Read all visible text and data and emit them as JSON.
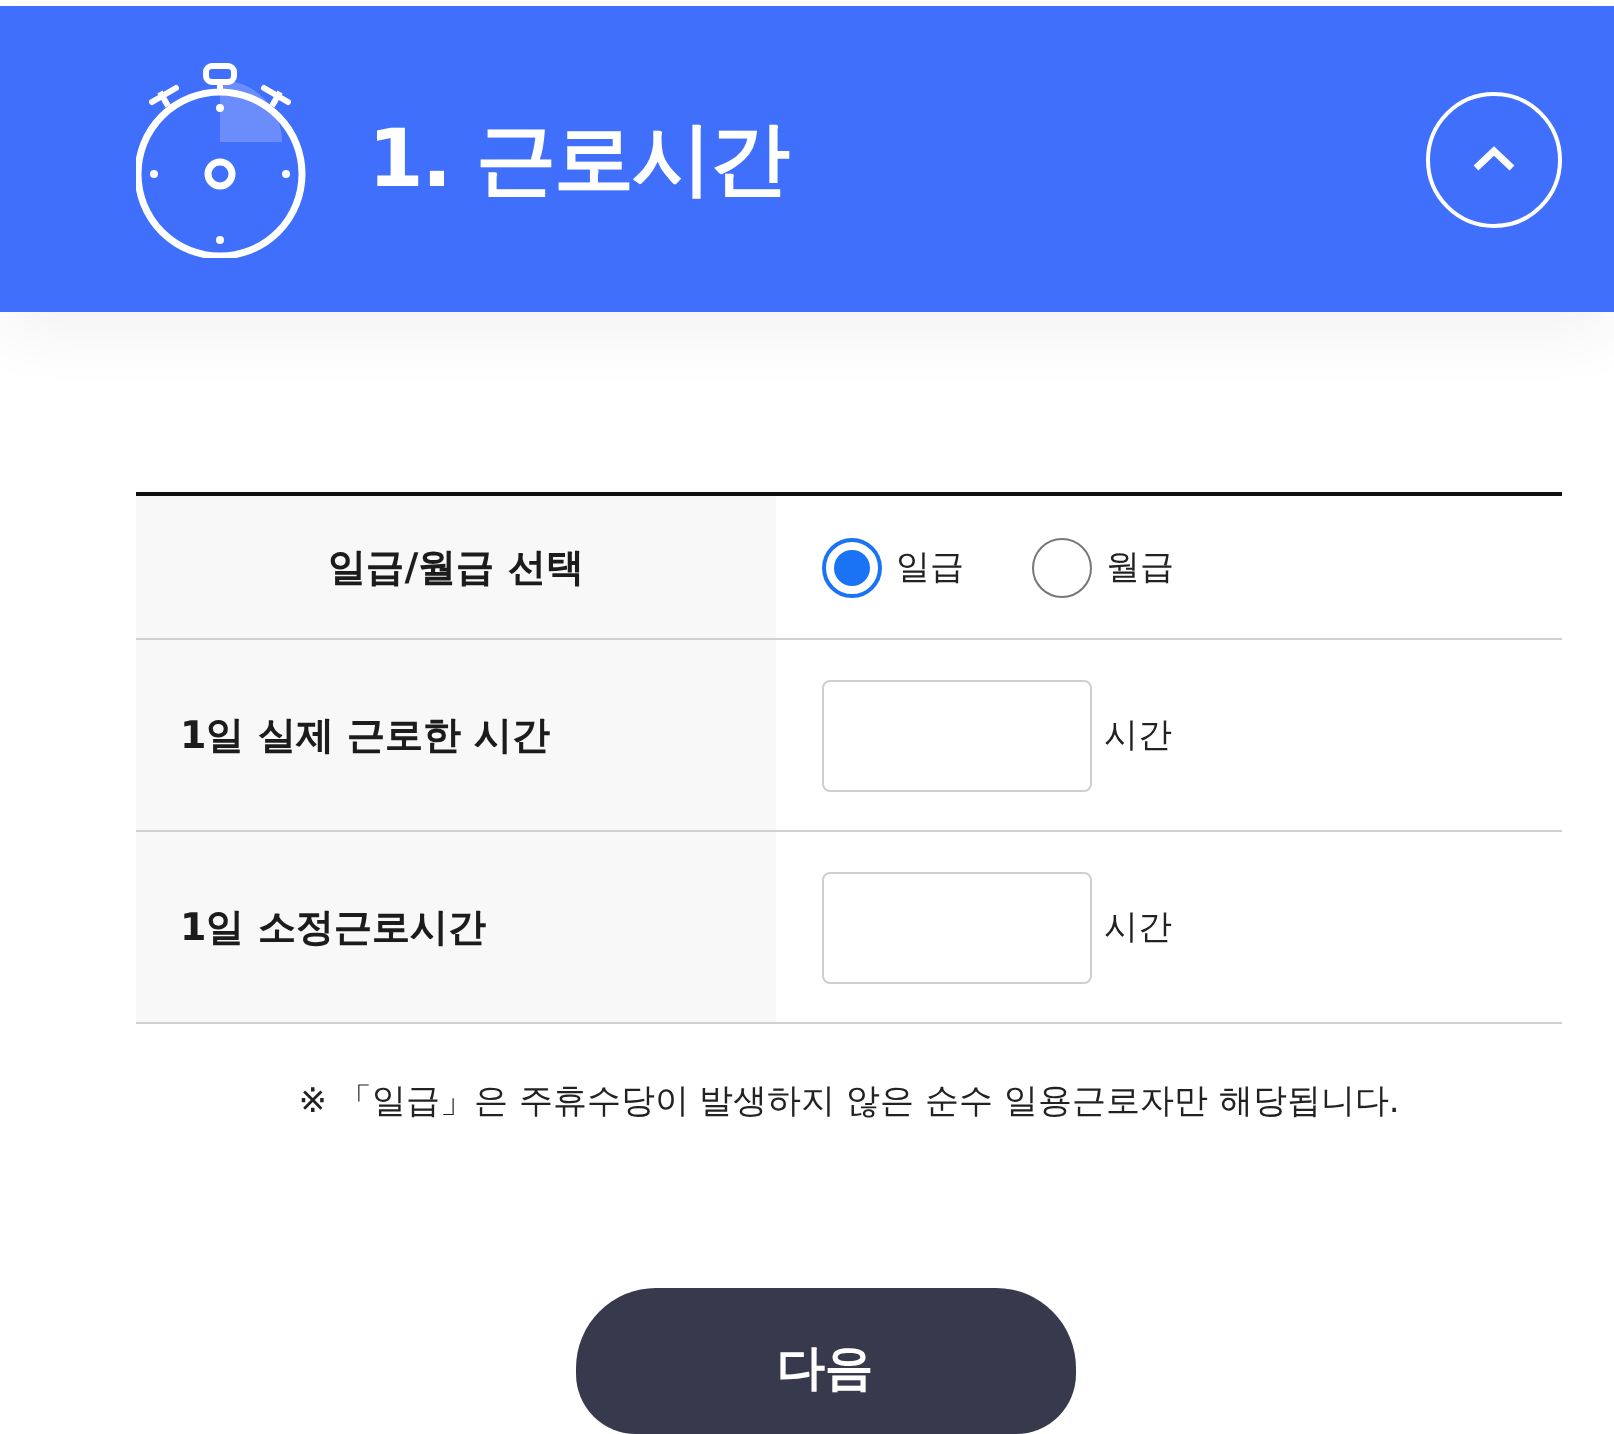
{
  "header": {
    "title": "1. 근로시간",
    "expanded": true
  },
  "table": {
    "rows": [
      {
        "kind": "radio",
        "label": "일급/월급 선택",
        "options": [
          {
            "label": "일급",
            "selected": true
          },
          {
            "label": "월급",
            "selected": false
          }
        ]
      },
      {
        "kind": "input",
        "label": "1일 실제 근로한 시간",
        "unit": "시간"
      },
      {
        "kind": "input",
        "label": "1일 소정근로시간",
        "unit": "시간"
      }
    ]
  },
  "note": "※ 「일급」은 주휴수당이 발생하지 않은 순수 일용근로자만 해당됩니다.",
  "next_button": "다음"
}
